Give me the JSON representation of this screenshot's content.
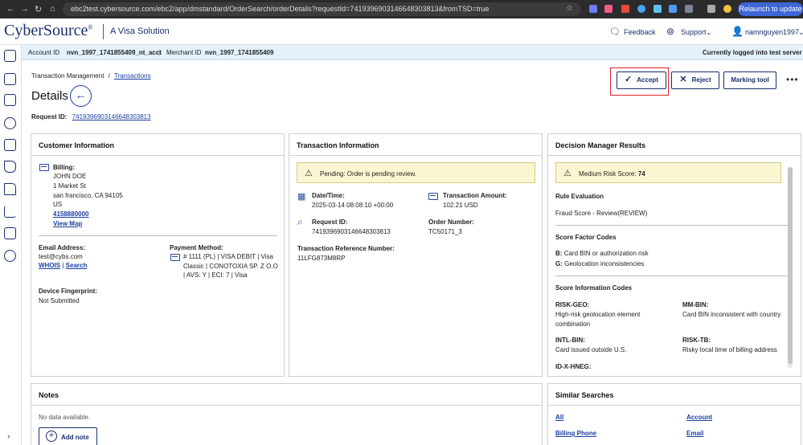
{
  "browser": {
    "url": "ebc2test.cybersource.com/ebc2/app/dmstandard/OrderSearch/orderDetails?requestId=7419396903146648303813&fromTSD=true",
    "relaunch_label": "Relaunch to update"
  },
  "header": {
    "brand": "CyberSource",
    "brand_mark": "®",
    "brand_tagline": "A Visa Solution",
    "feedback": "Feedback",
    "support": "Support",
    "user": "namnguyen1997"
  },
  "account_bar": {
    "account_id_label": "Account ID",
    "account_id": "nvn_1997_1741855409_nt_acct",
    "merchant_id_label": "Merchant ID",
    "merchant_id": "nvn_1997_1741855409",
    "status": "Currently logged into test server"
  },
  "breadcrumb": {
    "root": "Transaction Management",
    "sep": "/",
    "current": "Transactions"
  },
  "page": {
    "title": "Details",
    "request_id_label": "Request ID:",
    "request_id": "7419396903146648303813"
  },
  "actions": {
    "accept": "Accept",
    "reject": "Reject",
    "marking_tool": "Marking tool",
    "more": "•••"
  },
  "customer": {
    "title": "Customer Information",
    "billing_label": "Billing:",
    "billing_lines": [
      "JOHN DOE",
      "1 Market St",
      "san francisco, CA 94105",
      "US"
    ],
    "phone": "4158880000",
    "view_map": "View Map",
    "email_label": "Email Address:",
    "email": "test@cybs.com",
    "whois": "WHOIS",
    "pipe": "|",
    "search": "Search",
    "payment_label": "Payment Method:",
    "payment_lines": [
      "# 1111 (PL) | VISA DEBIT | Visa",
      "Classic | CONOTOXIA SP. Z O.O",
      "| AVS: Y | ECI: 7 | Visa"
    ],
    "device_label": "Device Fingerprint:",
    "device_value": "Not Submitted"
  },
  "transaction": {
    "title": "Transaction Information",
    "alert": "Pending: Order is pending review.",
    "datetime_label": "Date/Time:",
    "datetime": "2025-03-14 08:08:10 +00:00",
    "amount_label": "Transaction Amount:",
    "amount": "102.21 USD",
    "request_label": "Request ID:",
    "request_id": "7419396903146648303813",
    "order_label": "Order Number:",
    "order_number": "TC50171_3",
    "ref_label": "Transaction Reference Number:",
    "ref_number": "11LFG873M8RP"
  },
  "decision": {
    "title": "Decision Manager Results",
    "alert_label": "Medium Risk Score:",
    "alert_score": "74",
    "rule_eval_label": "Rule Evaluation",
    "rule_eval_value": "Fraud Score - Review(REVIEW)",
    "score_factor_label": "Score Factor Codes",
    "factors": [
      {
        "code": "B:",
        "text": "Card BIN or authorization risk"
      },
      {
        "code": "G:",
        "text": "Geolocation inconsistencies"
      }
    ],
    "info_codes_label": "Score Information Codes",
    "info_codes": [
      {
        "code": "RISK-GEO:",
        "lines": [
          "High-risk geolocation element",
          "combination"
        ]
      },
      {
        "code": "MM-BIN:",
        "lines": [
          "Card BIN inconsistent with country"
        ]
      },
      {
        "code": "INTL-BIN:",
        "lines": [
          "Card issued outside U.S."
        ]
      },
      {
        "code": "RISK-TB:",
        "lines": [
          "Risky local time of billing address"
        ]
      },
      {
        "code": "ID-X-HNEG:",
        "lines": []
      }
    ]
  },
  "notes": {
    "title": "Notes",
    "empty": "No data available.",
    "add_note": "Add note"
  },
  "similar": {
    "title": "Similar Searches",
    "links": [
      "All",
      "Account",
      "Billing Phone",
      "Email"
    ]
  }
}
